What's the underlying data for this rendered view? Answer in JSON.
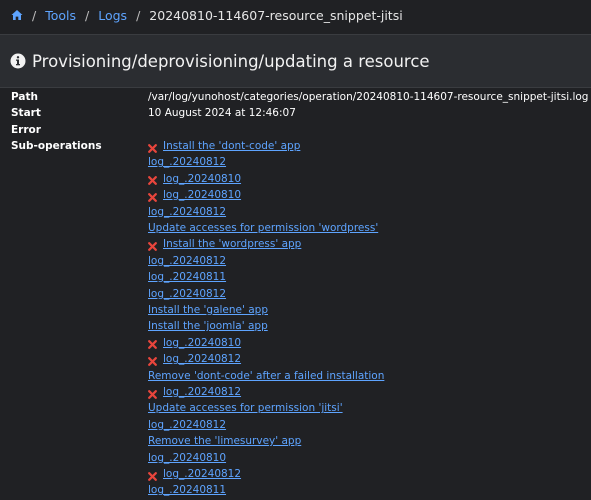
{
  "breadcrumb": {
    "tools": "Tools",
    "logs": "Logs",
    "current": "20240810-114607-resource_snippet-jitsi",
    "separator": "/"
  },
  "title": "Provisioning/deprovisioning/updating a resource",
  "details": {
    "path_label": "Path",
    "path_value": "/var/log/yunohost/categories/operation/20240810-114607-resource_snippet-jitsi.log",
    "start_label": "Start",
    "start_value": "10 August 2024 at 12:46:07",
    "error_label": "Error",
    "error_value": "",
    "subops_label": "Sub-operations"
  },
  "sub_operations": [
    {
      "label": "Install the 'dont-code' app",
      "failed": true
    },
    {
      "label": "log_.20240812",
      "failed": false
    },
    {
      "label": "log_.20240810",
      "failed": true
    },
    {
      "label": "log_.20240810",
      "failed": true
    },
    {
      "label": "log_.20240812",
      "failed": false
    },
    {
      "label": "Update accesses for permission 'wordpress'",
      "failed": false
    },
    {
      "label": "Install the 'wordpress' app",
      "failed": true
    },
    {
      "label": "log_.20240812",
      "failed": false
    },
    {
      "label": "log_.20240811",
      "failed": false
    },
    {
      "label": "log_.20240812",
      "failed": false
    },
    {
      "label": "Install the 'galene' app",
      "failed": false
    },
    {
      "label": "Install the 'joomla' app",
      "failed": false
    },
    {
      "label": "log_.20240810",
      "failed": true
    },
    {
      "label": "log_.20240812",
      "failed": true
    },
    {
      "label": "Remove 'dont-code' after a failed installation",
      "failed": false
    },
    {
      "label": "log_.20240812",
      "failed": true
    },
    {
      "label": "Update accesses for permission 'jitsi'",
      "failed": false
    },
    {
      "label": "log_.20240812",
      "failed": false
    },
    {
      "label": "Remove the 'limesurvey' app",
      "failed": false
    },
    {
      "label": "log_.20240810",
      "failed": false
    },
    {
      "label": "log_.20240812",
      "failed": true
    },
    {
      "label": "log_.20240811",
      "failed": false
    }
  ],
  "colors": {
    "link": "#5ea4ff",
    "error_icon": "#e8453c",
    "background": "#202124",
    "header": "#2b2d31"
  },
  "icons": {
    "home": "home-icon",
    "info": "info-circle-icon",
    "failed": "times-icon"
  }
}
